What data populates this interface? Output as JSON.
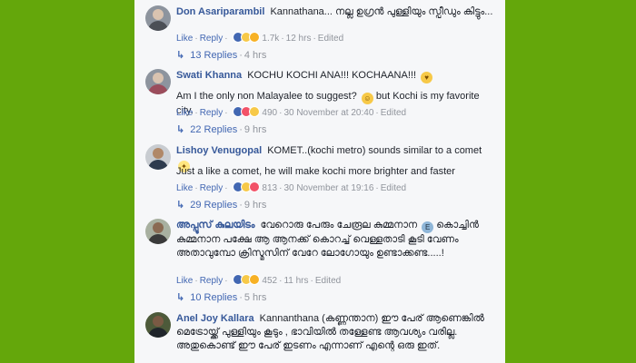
{
  "comments": [
    {
      "author": "Don Asariparambil",
      "text": "Kannathana... നല്ല ഉഗ്രൻ പുള്ളിയും സ്പീഡും കിട്ടും...",
      "like": "Like",
      "reply": "Reply",
      "reaction_count": "1.7k",
      "time": "12 hrs",
      "edited": "Edited",
      "replies_label": "13 Replies",
      "replies_time": "4 hrs"
    },
    {
      "author": "Swati Khanna",
      "text": "KOCHU KOCHI ANA!!! KOCHAANA!!!",
      "text2": "Am I the only non Malayalee to suggest?",
      "text2b": "but Kochi is my favorite city.",
      "like": "Like",
      "reply": "Reply",
      "reaction_count": "490",
      "time": "30 November at 20:40",
      "edited": "Edited",
      "replies_label": "22 Replies",
      "replies_time": "9 hrs"
    },
    {
      "author": "Lishoy Venugopal",
      "text": "KOMET..(kochi metro) sounds similar to a comet",
      "text2": "Just a like a comet, he will make kochi more brighter and faster",
      "like": "Like",
      "reply": "Reply",
      "reaction_count": "813",
      "time": "30 November at 19:16",
      "edited": "Edited",
      "replies_label": "29 Replies",
      "replies_time": "9 hrs"
    },
    {
      "author": "അപ്പൂസ് കുലയിടം",
      "text": "വേറൊരു പേരും ചേരൂല കുമ്മനാന",
      "text2": "കൊച്ചിൻ കുമ്മനാന പക്ഷേ ആ ആനക്ക് കൊറച്ച് വെള്ളതാടി കൂടി വേണം അതാവുമ്പോ ക്രിസ്മസിന് വേറേ ലോഗോയും ഉണ്ടാക്കണ്ട.....!",
      "like": "Like",
      "reply": "Reply",
      "reaction_count": "452",
      "time": "11 hrs",
      "edited": "Edited",
      "replies_label": "10 Replies",
      "replies_time": "5 hrs"
    },
    {
      "author": "Anel Joy Kallara",
      "text": "Kannanthana (കണ്ണന്താന) ഈ പേര് ആണെങ്കിൽ മെട്രോയ്ക്ക് പുള്ളിയും കൂടും , ഭാവിയിൽ തള്ളേണ്ട ആവശ്യം വരില്ല. അതുകൊണ്ട് ഈ പേര് ഇടണം എന്നാണ് എന്റെ ഒരു ഇത്."
    }
  ],
  "colors": {
    "background": "#64a70b",
    "panel": "#f6f7f9",
    "author": "#365899",
    "link": "#4267b2",
    "meta": "#90949c"
  }
}
